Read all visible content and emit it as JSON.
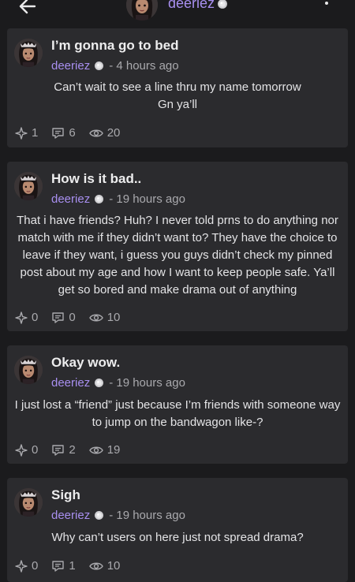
{
  "header": {
    "username": "deeriez"
  },
  "posts": [
    {
      "title": "I’m gonna go to bed",
      "author": "deeriez",
      "time": "- 4 hours ago",
      "body": "Can’t wait to see a line thru my name tomorrow\nGn ya’ll",
      "likes": "1",
      "comments": "6",
      "views": "20"
    },
    {
      "title": "How is it bad..",
      "author": "deeriez",
      "time": "- 19 hours ago",
      "body": "That i have friends? Huh? I never told prns to do anything nor match with me if they didn’t want to? They have the choice to leave if they want, i guess you guys didn’t check my pinned post about my age and how I want to keep people safe. Ya’ll get so bored and make drama out of anything",
      "likes": "0",
      "comments": "0",
      "views": "10"
    },
    {
      "title": "Okay wow.",
      "author": "deeriez",
      "time": "- 19 hours ago",
      "body": "I just lost a “friend” just because I’m friends with someone way to jump on the bandwagon like-?",
      "likes": "0",
      "comments": "2",
      "views": "19"
    },
    {
      "title": "Sigh",
      "author": "deeriez",
      "time": "- 19 hours ago",
      "body": "Why can’t users on here just not spread drama?",
      "likes": "0",
      "comments": "1",
      "views": "10"
    }
  ],
  "colors": {
    "background": "#1b1b1d",
    "card": "#2b2b2e",
    "accent": "#a88ff0",
    "muted": "#a9a9ad"
  },
  "icons": [
    "back-arrow-icon",
    "more-vertical-icon",
    "verified-badge-icon",
    "sparkle-icon",
    "comment-icon",
    "eye-icon"
  ]
}
